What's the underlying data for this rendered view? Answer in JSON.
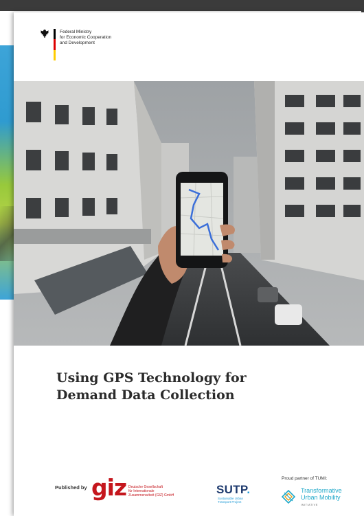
{
  "issuer": {
    "lines": [
      "Federal Ministry",
      "for Economic Cooperation",
      "and Development"
    ],
    "icon": "federal-eagle-icon",
    "flag_colors": [
      "#000000",
      "#dd0000",
      "#ffcc00"
    ]
  },
  "document": {
    "title_lines": [
      "Using GPS Technology for",
      "Demand Data Collection"
    ]
  },
  "publisher": {
    "published_by": "Published by",
    "giz_wordmark": "giz",
    "giz_sub_lines": [
      "Deutsche Gesellschaft",
      "für Internationale",
      "Zusammenarbeit (GIZ) GmbH"
    ]
  },
  "partner_sutp": {
    "wordmark": "SUTP",
    "dot": ".",
    "sub_lines": [
      "Sustainable Urban",
      "Transport Project"
    ]
  },
  "partner_tumi": {
    "caption": "Proud partner of TUMI:",
    "lines": [
      "Transformative",
      "Urban Mobility"
    ],
    "initiative": "INITIATIVE",
    "icon": "tumi-diamond-icon"
  },
  "colors": {
    "giz_red": "#c5161d",
    "sutp_navy": "#1e3a6e",
    "tumi_cyan": "#1fa8c9"
  }
}
